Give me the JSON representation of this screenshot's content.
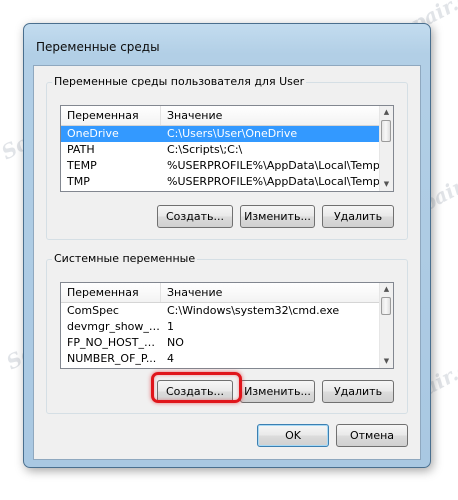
{
  "window": {
    "title": "Переменные среды"
  },
  "user_vars": {
    "group_title": "Переменные среды пользователя для User",
    "columns": [
      "Переменная",
      "Значение"
    ],
    "rows": [
      {
        "name": "OneDrive",
        "value": "C:\\Users\\User\\OneDrive",
        "selected": true
      },
      {
        "name": "PATH",
        "value": "C:\\Scripts\\;C:\\"
      },
      {
        "name": "TEMP",
        "value": "%USERPROFILE%\\AppData\\Local\\Temp"
      },
      {
        "name": "TMP",
        "value": "%USERPROFILE%\\AppData\\Local\\Temp"
      }
    ],
    "buttons": {
      "create": "Создать...",
      "edit": "Изменить...",
      "delete": "Удалить"
    }
  },
  "system_vars": {
    "group_title": "Системные переменные",
    "columns": [
      "Переменная",
      "Значение"
    ],
    "rows": [
      {
        "name": "ComSpec",
        "value": "C:\\Windows\\system32\\cmd.exe"
      },
      {
        "name": "devmgr_show_n...",
        "value": "1"
      },
      {
        "name": "FP_NO_HOST_C...",
        "value": "NO"
      },
      {
        "name": "NUMBER_OF_P...",
        "value": "4"
      }
    ],
    "buttons": {
      "create": "Создать...",
      "edit": "Изменить...",
      "delete": "Удалить"
    }
  },
  "footer": {
    "ok": "OK",
    "cancel": "Отмена"
  },
  "watermark": "Soringpcrepair.com",
  "colors": {
    "selection": "#3399ff",
    "highlight": "#e0151b"
  }
}
